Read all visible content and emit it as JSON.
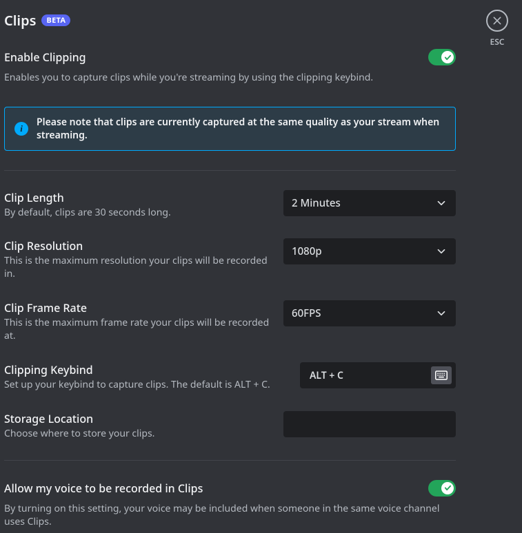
{
  "header": {
    "title": "Clips",
    "badge": "BETA"
  },
  "close": {
    "esc_label": "ESC"
  },
  "enable_clipping": {
    "title": "Enable Clipping",
    "description": "Enables you to capture clips while you're streaming by using the clipping keybind.",
    "enabled": true
  },
  "info_note": {
    "text": "Please note that clips are currently captured at the same quality as your stream when streaming."
  },
  "clip_length": {
    "title": "Clip Length",
    "description": "By default, clips are 30 seconds long.",
    "value": "2 Minutes"
  },
  "clip_resolution": {
    "title": "Clip Resolution",
    "description": "This is the maximum resolution your clips will be recorded in.",
    "value": "1080p"
  },
  "clip_framerate": {
    "title": "Clip Frame Rate",
    "description": "This is the maximum frame rate your clips will be recorded at.",
    "value": "60FPS"
  },
  "clipping_keybind": {
    "title": "Clipping Keybind",
    "description": "Set up your keybind to capture clips. The default is ALT + C.",
    "value": "ALT + C"
  },
  "storage_location": {
    "title": "Storage Location",
    "description": "Choose where to store your clips.",
    "value": ""
  },
  "allow_voice": {
    "title": "Allow my voice to be recorded in Clips",
    "description": "By turning on this setting, your voice may be included when someone in the same voice channel uses Clips.",
    "enabled": true
  }
}
